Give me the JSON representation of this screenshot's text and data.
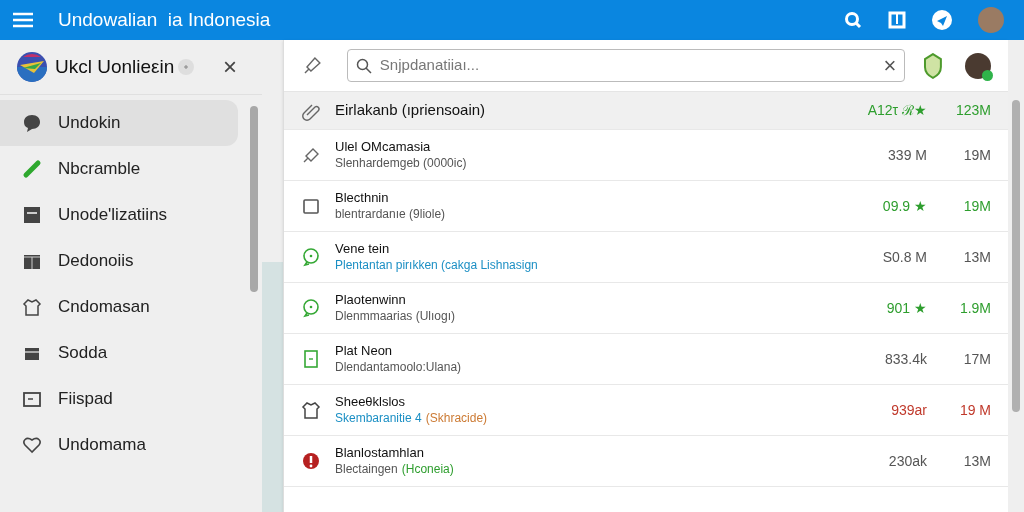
{
  "app_bar": {
    "title": "Undowalian  ia Indonesia"
  },
  "sidebar": {
    "title": "Ukcl Uonlieεin",
    "close": "×",
    "items": [
      {
        "label": "Undokin",
        "kind": "chat",
        "selected": true
      },
      {
        "label": "Nbcramble",
        "kind": "link",
        "selected": false
      },
      {
        "label": "Unode'lizatiins",
        "kind": "card",
        "selected": false
      },
      {
        "label": "Dedonoiis",
        "kind": "calendar",
        "selected": false
      },
      {
        "label": "Cndomasan",
        "kind": "shirt",
        "selected": false
      },
      {
        "label": "Sodda",
        "kind": "box",
        "selected": false
      },
      {
        "label": "Fiispad",
        "kind": "folder",
        "selected": false
      },
      {
        "label": "Undomama",
        "kind": "heart",
        "selected": false
      }
    ]
  },
  "search": {
    "placeholder": "Snjpdanatiiaı...",
    "clear": "×"
  },
  "rows": [
    {
      "kind": "clip",
      "title": "Eirlakanb (ıpriensoain)",
      "subtitle": [],
      "rating": "A12τ ℛ★",
      "size": "123M",
      "color": "#2e9e2e",
      "selected": true
    },
    {
      "kind": "pin",
      "title": "Ulel OMcamasia",
      "subtitle": [
        {
          "text": "Slenhardemgeb (0000ic)",
          "color": "#555555"
        }
      ],
      "rating": "339 M",
      "size": "19M",
      "color": "#555555",
      "selected": false
    },
    {
      "kind": "square",
      "title": "Blecthnin",
      "subtitle": [
        {
          "text": "blentrardanıe (9liole)",
          "color": "#555555"
        }
      ],
      "rating": "09.9 ★",
      "size": "19M",
      "color": "#2e9e2e",
      "selected": false
    },
    {
      "kind": "bubble",
      "title": "Vene tein",
      "subtitle": [
        {
          "text": "Plentantan pirıkken (cakga Lishnasign",
          "color": "#1b8fc4"
        }
      ],
      "rating": "S0.8 M",
      "size": "13M",
      "color": "#555555",
      "selected": false
    },
    {
      "kind": "bubble",
      "title": "Plaotenwinn",
      "subtitle": [
        {
          "text": "Dlenmmaarias (Ulıogı)",
          "color": "#555555"
        }
      ],
      "rating": "901 ★",
      "size": "1.9M",
      "color": "#2e9e2e",
      "selected": false
    },
    {
      "kind": "doc",
      "title": "Plat Neon",
      "subtitle": [
        {
          "text": "Dlendantamoolo:Ulana)",
          "color": "#555555"
        }
      ],
      "rating": "833.4k",
      "size": "17M",
      "color": "#555555",
      "selected": false
    },
    {
      "kind": "shirt",
      "title": "Sheeθklslos",
      "subtitle": [
        {
          "text": "Skembaranitie 4",
          "color": "#1b8fc4"
        },
        {
          "text": "(Skhracide)",
          "color": "#cc7a33"
        }
      ],
      "rating": "939ar",
      "size": "19 M",
      "color": "#c0392b",
      "selected": false
    },
    {
      "kind": "badge",
      "title": "Blanlostamhlan",
      "subtitle": [
        {
          "text": "Blectaingen",
          "color": "#555555"
        },
        {
          "text": "(Hconeia)",
          "color": "#2e9e2e"
        }
      ],
      "rating": "230ak",
      "size": "13M",
      "color": "#555555",
      "selected": false
    }
  ]
}
